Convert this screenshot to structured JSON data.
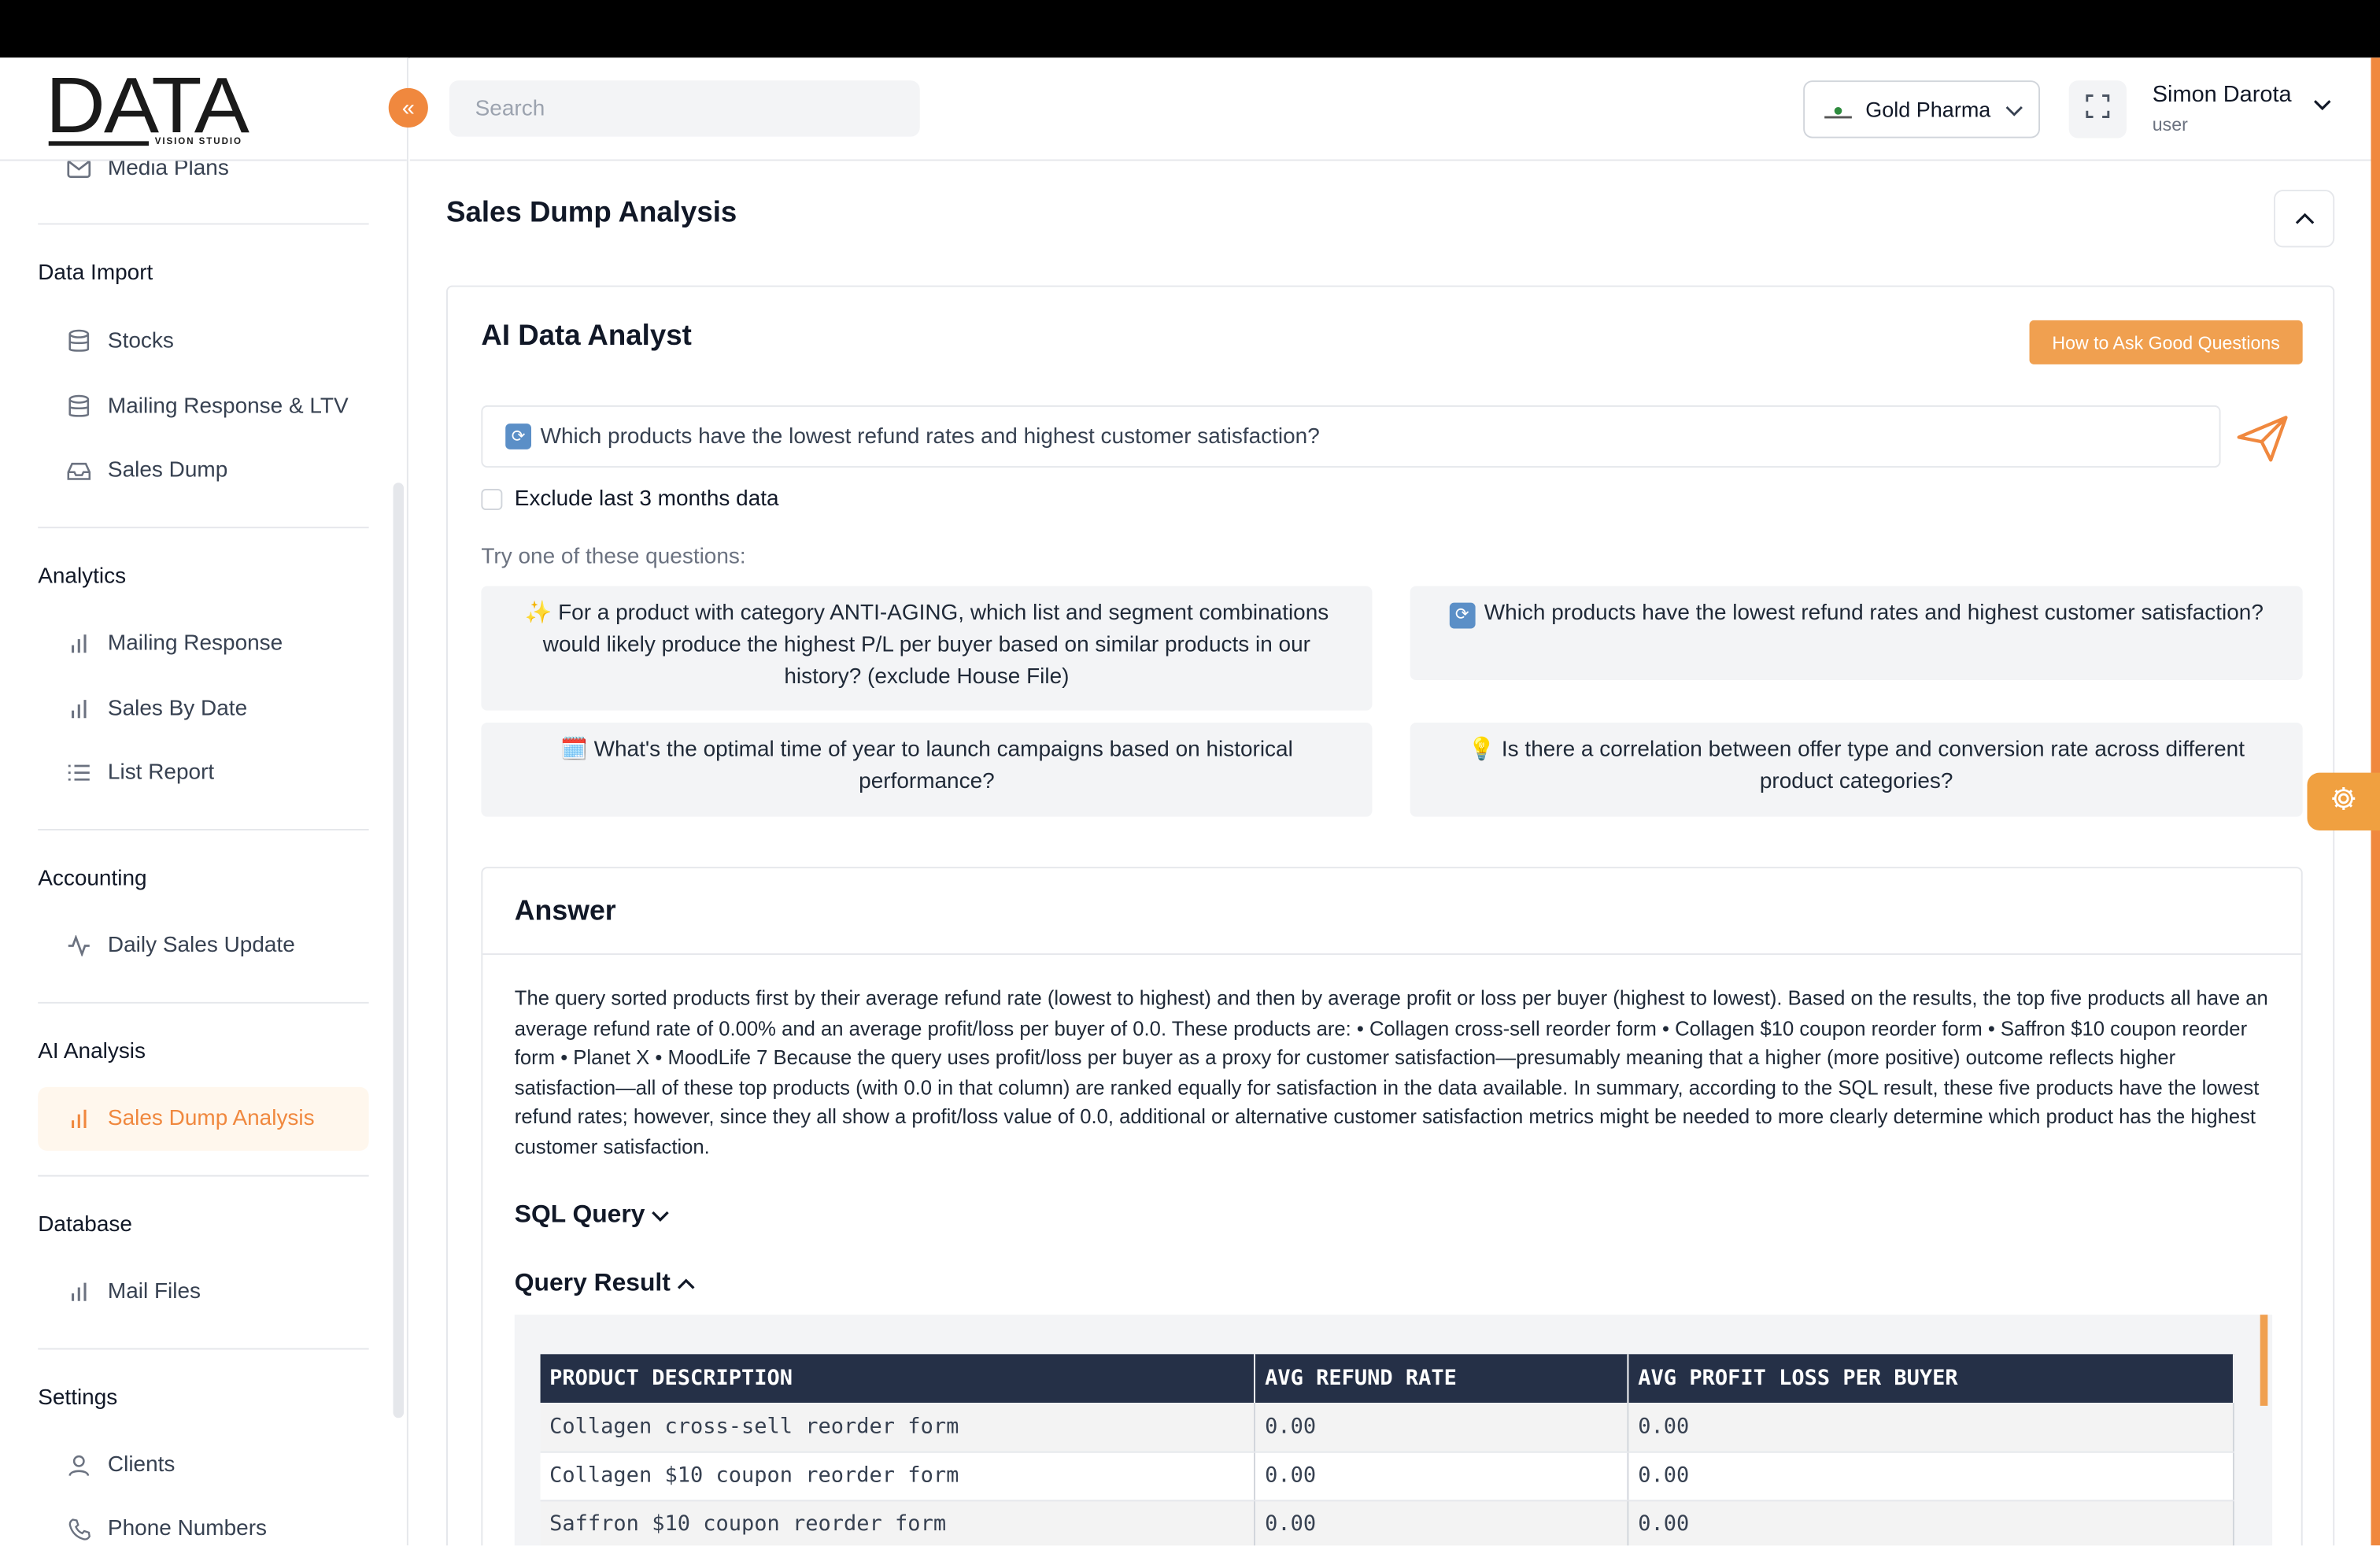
{
  "brand": {
    "logo_text": "DATA",
    "logo_sub": "VISION STUDIO"
  },
  "sidebar": {
    "items_top": [
      {
        "label": "Media Plans",
        "icon": "mail-icon"
      }
    ],
    "sections": [
      {
        "heading": "Data Import",
        "items": [
          {
            "label": "Stocks",
            "icon": "database-icon"
          },
          {
            "label": "Mailing Response & LTV",
            "icon": "database-icon"
          },
          {
            "label": "Sales Dump",
            "icon": "inbox-icon"
          }
        ]
      },
      {
        "heading": "Analytics",
        "items": [
          {
            "label": "Mailing Response",
            "icon": "bar-chart-icon"
          },
          {
            "label": "Sales By Date",
            "icon": "bar-chart-icon"
          },
          {
            "label": "List Report",
            "icon": "list-icon"
          }
        ]
      },
      {
        "heading": "Accounting",
        "items": [
          {
            "label": "Daily Sales Update",
            "icon": "activity-icon"
          }
        ]
      },
      {
        "heading": "AI Analysis",
        "items": [
          {
            "label": "Sales Dump Analysis",
            "icon": "bar-chart-icon",
            "active": true
          }
        ]
      },
      {
        "heading": "Database",
        "items": [
          {
            "label": "Mail Files",
            "icon": "bar-chart-icon"
          }
        ]
      },
      {
        "heading": "Settings",
        "items": [
          {
            "label": "Clients",
            "icon": "user-icon"
          },
          {
            "label": "Phone Numbers",
            "icon": "phone-icon"
          }
        ]
      }
    ]
  },
  "header": {
    "search_placeholder": "Search",
    "client": "Gold Pharma",
    "user_name": "Simon Darota",
    "user_role": "user"
  },
  "page": {
    "title": "Sales Dump Analysis",
    "card_title": "AI Data Analyst",
    "howto_label": "How to Ask Good Questions",
    "question": "Which products have the lowest refund rates and highest customer satisfaction?",
    "exclude_label": "Exclude last 3 months data",
    "try_label": "Try one of these questions:",
    "suggestions": [
      {
        "icon": "✨",
        "text": "For a product with category ANTI-AGING, which list and segment combinations would likely produce the highest P/L per buyer based on similar products in our history? (exclude House File)"
      },
      {
        "icon": "🔄",
        "text": "Which products have the lowest refund rates and highest customer satisfaction?"
      },
      {
        "icon": "🗓️",
        "text": "What's the optimal time of year to launch campaigns based on historical performance?"
      },
      {
        "icon": "💡",
        "text": "Is there a correlation between offer type and conversion rate across different product categories?"
      }
    ],
    "answer_title": "Answer",
    "answer_text": "The query sorted products first by their average refund rate (lowest to highest) and then by average profit or loss per buyer (highest to lowest). Based on the results, the top five products all have an average refund rate of 0.00% and an average profit/loss per buyer of 0.0. These products are: • Collagen cross-sell reorder form • Collagen $10 coupon reorder form • Saffron $10 coupon reorder form • Planet X • MoodLife 7 Because the query uses profit/loss per buyer as a proxy for customer satisfaction—presumably meaning that a higher (more positive) outcome reflects higher satisfaction—all of these top products (with 0.0 in that column) are ranked equally for satisfaction in the data available. In summary, according to the SQL result, these five products have the lowest refund rates; however, since they all show a profit/loss value of 0.0, additional or alternative customer satisfaction metrics might be needed to more clearly determine which product has the highest customer satisfaction.",
    "sql_label": "SQL Query",
    "result_label": "Query Result",
    "table": {
      "columns": [
        "PRODUCT DESCRIPTION",
        "AVG REFUND RATE",
        "AVG PROFIT LOSS PER BUYER"
      ],
      "rows": [
        [
          "Collagen cross-sell reorder form",
          "0.00",
          "0.00"
        ],
        [
          "Collagen $10 coupon reorder form",
          "0.00",
          "0.00"
        ],
        [
          "Saffron $10 coupon reorder form",
          "0.00",
          "0.00"
        ]
      ]
    }
  },
  "colors": {
    "accent": "#f0883e",
    "table_header": "#253047"
  }
}
